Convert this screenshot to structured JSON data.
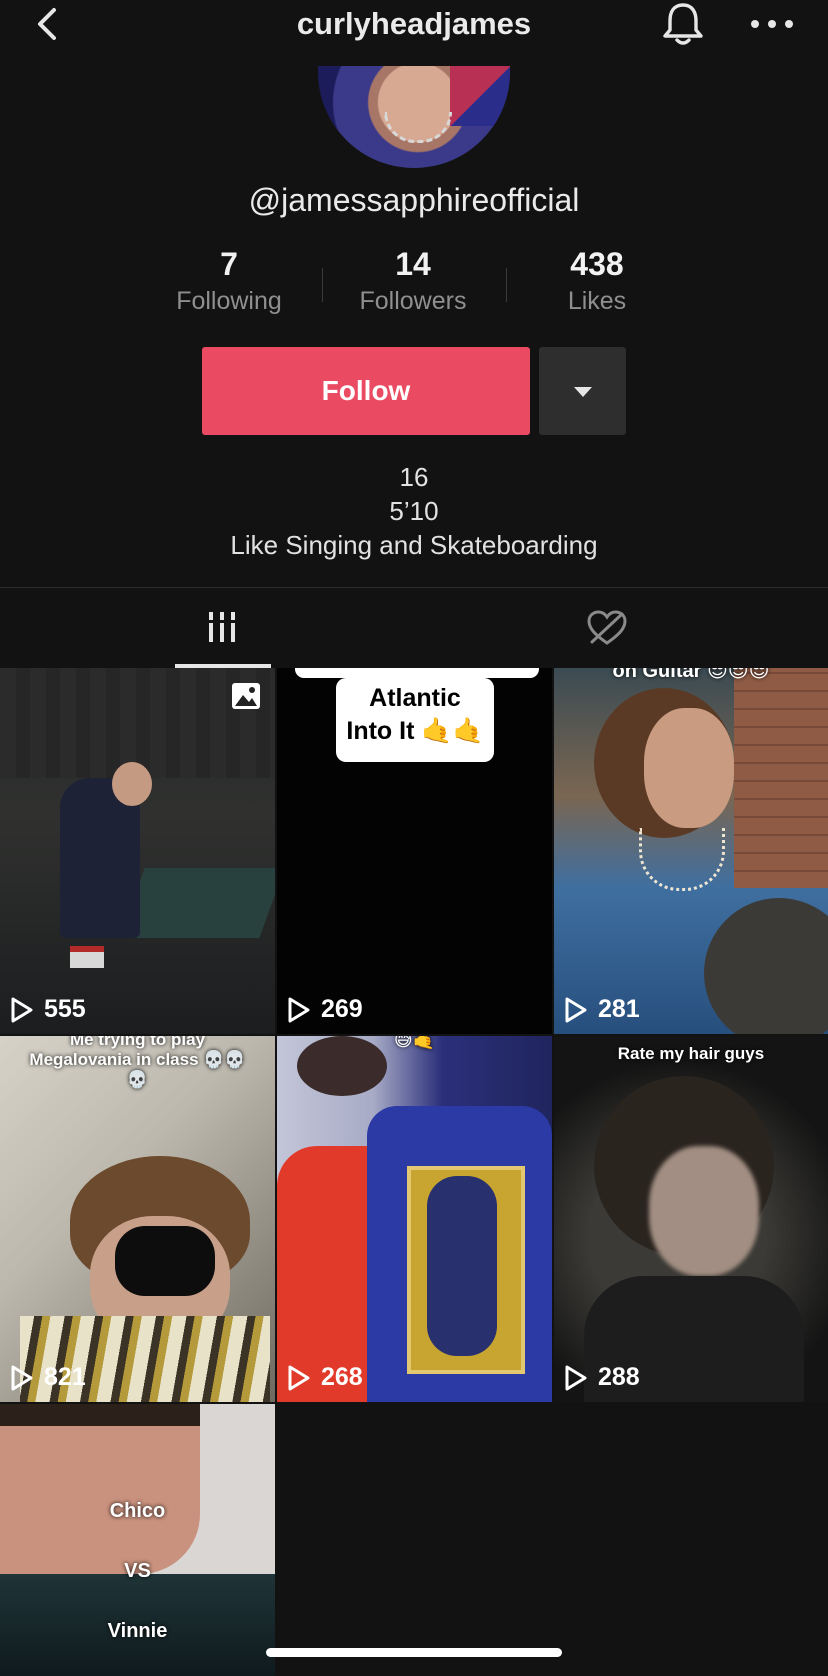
{
  "header": {
    "title": "curlyheadjames",
    "back_icon": "chevron-left-icon",
    "bell_icon": "bell-icon",
    "more_icon": "more-horizontal-icon"
  },
  "profile": {
    "handle": "@jamessapphireofficial",
    "stats": [
      {
        "value": "7",
        "label": "Following"
      },
      {
        "value": "14",
        "label": "Followers"
      },
      {
        "value": "438",
        "label": "Likes"
      }
    ],
    "follow_label": "Follow",
    "bio": [
      "16",
      "5’10",
      "Like Singing and Skateboarding"
    ]
  },
  "tabs": [
    {
      "name": "videos",
      "icon": "grid-icon",
      "active": true
    },
    {
      "name": "liked",
      "icon": "liked-hidden-icon",
      "active": false
    }
  ],
  "colors": {
    "accent": "#ea4b62",
    "background": "#121212"
  },
  "videos": [
    {
      "views": "555",
      "photo_badge": "photo-icon"
    },
    {
      "views": "269",
      "caption_lines": [
        "Atlantic",
        "Into It 🤙🤙"
      ]
    },
    {
      "views": "281",
      "caption_top": "on Guitar 😎😎😎"
    },
    {
      "views": "821",
      "caption_lines": [
        "Me trying to play",
        "Megalovania in class 💀💀",
        "💀"
      ]
    },
    {
      "views": "268",
      "caption_top": "😅🤙"
    },
    {
      "views": "288",
      "caption_top": "Rate my hair guys"
    },
    {
      "views": "",
      "caption_lines": [
        "Chico",
        "VS",
        "Vinnie"
      ]
    }
  ]
}
